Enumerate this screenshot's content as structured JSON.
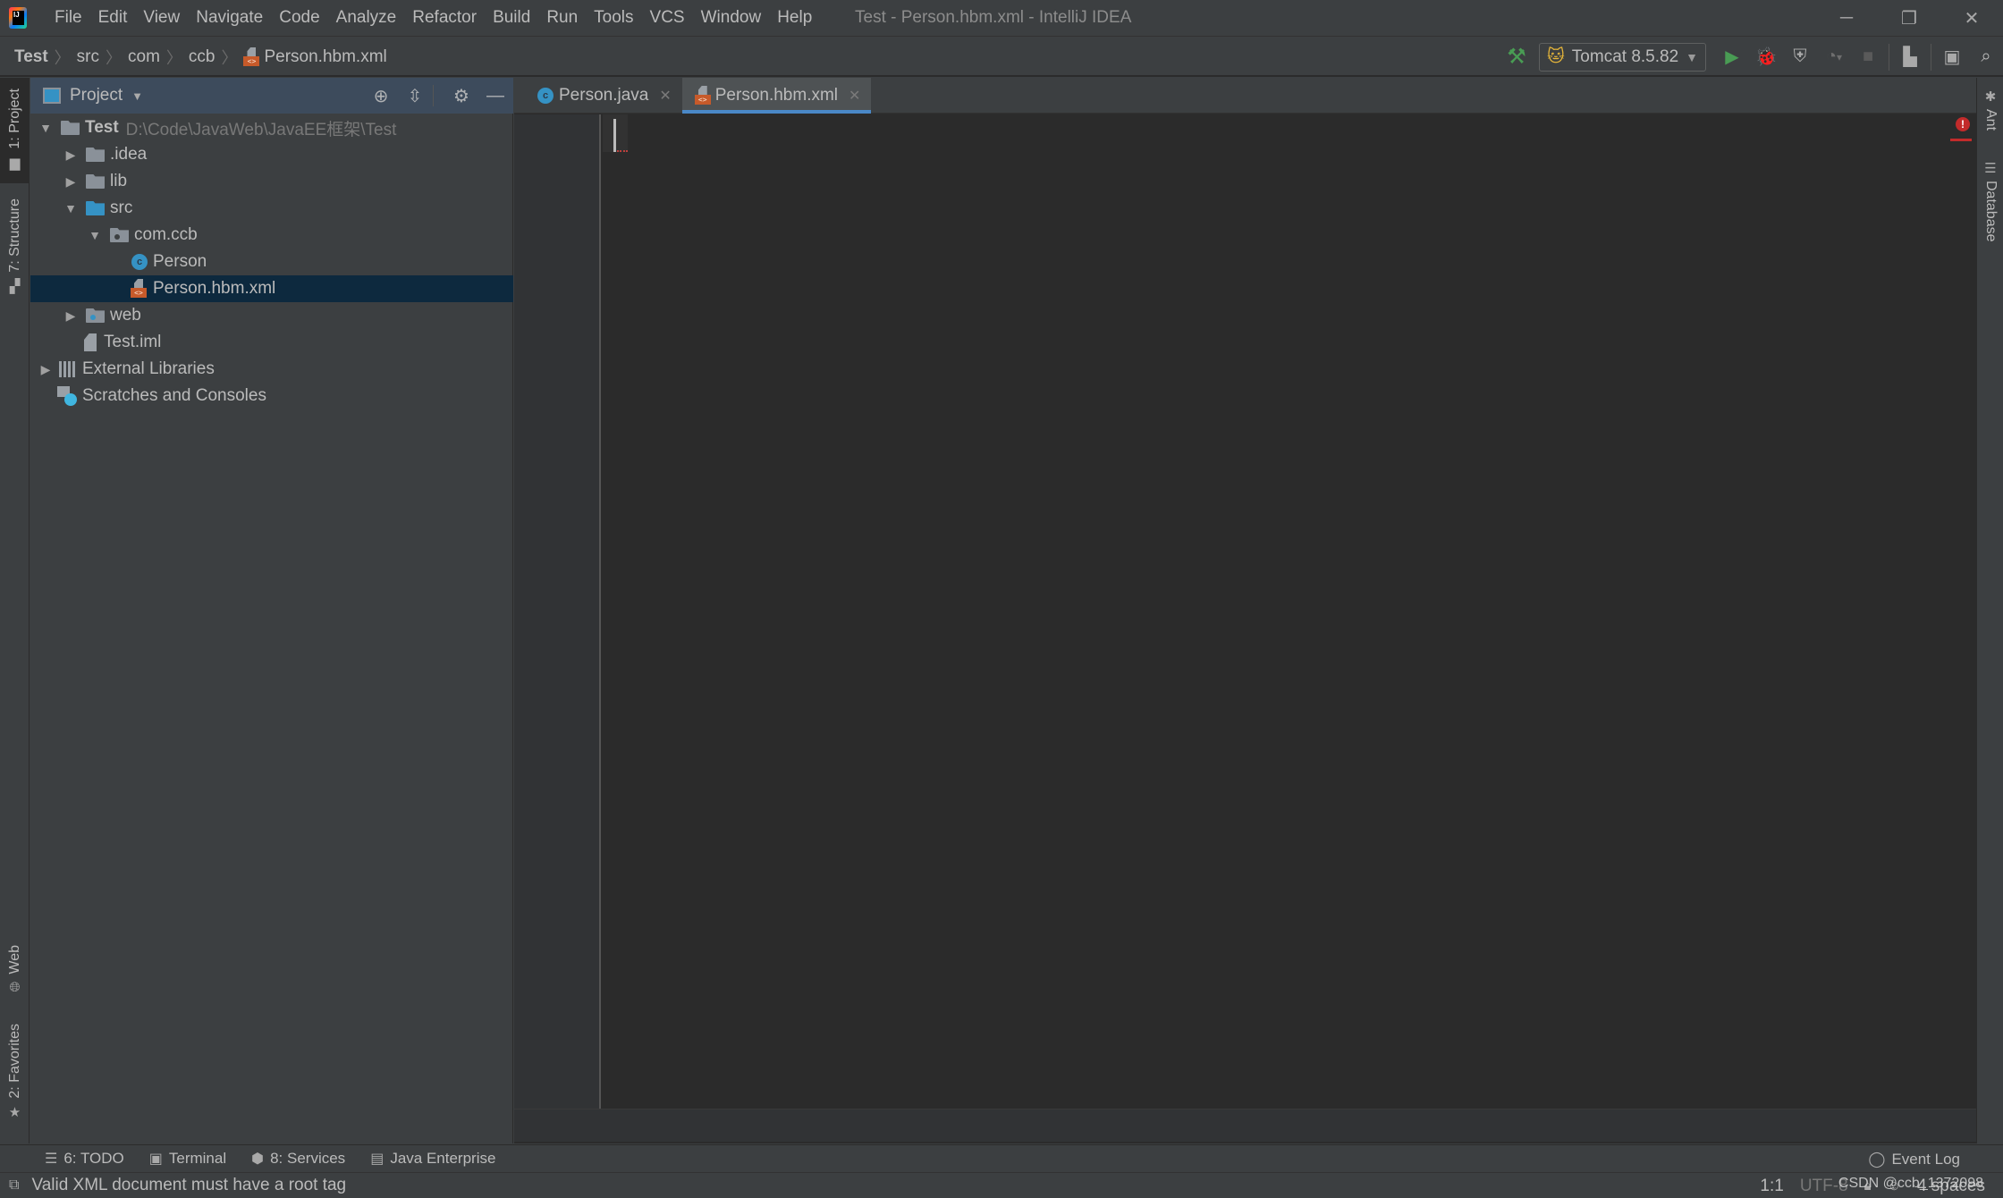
{
  "window": {
    "title": "Test - Person.hbm.xml - IntelliJ IDEA",
    "logo_glyph": "IJ",
    "controls": {
      "minimize": "─",
      "restore": "❐",
      "close": "✕"
    }
  },
  "menu": [
    "File",
    "Edit",
    "View",
    "Navigate",
    "Code",
    "Analyze",
    "Refactor",
    "Build",
    "Run",
    "Tools",
    "VCS",
    "Window",
    "Help"
  ],
  "breadcrumb": [
    "Test",
    "src",
    "com",
    "ccb",
    "Person.hbm.xml"
  ],
  "toolbar": {
    "build_icon": "hammer-icon",
    "run_config": "Tomcat 8.5.82",
    "run_config_icon": "tomcat-icon",
    "icons": [
      "run-icon",
      "debug-icon",
      "run-with-coverage-icon",
      "profile-icon",
      "stop-icon",
      "project-structure-icon",
      "run-anything-icon",
      "search-everywhere-icon"
    ]
  },
  "left_strip": {
    "tabs": [
      {
        "label": "1: Project",
        "icon": "folder-icon",
        "active": true
      },
      {
        "label": "7: Structure",
        "icon": "structure-icon",
        "active": false
      },
      {
        "label": "Web",
        "icon": "globe-icon",
        "active": false
      },
      {
        "label": "2: Favorites",
        "icon": "star-icon",
        "active": false
      }
    ]
  },
  "project_panel": {
    "title": "Project",
    "tools": [
      "locate-icon",
      "collapse-all-icon",
      "gear-icon",
      "hide-icon"
    ],
    "tree": [
      {
        "label": "Test",
        "hint": "D:\\Code\\JavaWeb\\JavaEE框架\\Test",
        "depth": 0,
        "expanded": true,
        "icon": "module-folder",
        "bold": true
      },
      {
        "label": ".idea",
        "depth": 1,
        "expanded": false,
        "icon": "folder"
      },
      {
        "label": "lib",
        "depth": 1,
        "expanded": false,
        "icon": "folder"
      },
      {
        "label": "src",
        "depth": 1,
        "expanded": true,
        "icon": "source-folder"
      },
      {
        "label": "com.ccb",
        "depth": 2,
        "expanded": true,
        "icon": "package"
      },
      {
        "label": "Person",
        "depth": 3,
        "icon": "class"
      },
      {
        "label": "Person.hbm.xml",
        "depth": 3,
        "icon": "xml",
        "selected": true
      },
      {
        "label": "web",
        "depth": 1,
        "expanded": false,
        "icon": "web-folder"
      },
      {
        "label": "Test.iml",
        "depth": 1,
        "icon": "iml"
      },
      {
        "label": "External Libraries",
        "depth": 0,
        "expanded": false,
        "icon": "libraries"
      },
      {
        "label": "Scratches and Consoles",
        "depth": 0,
        "icon": "scratches"
      }
    ]
  },
  "editor": {
    "tabs": [
      {
        "label": "Person.java",
        "icon": "class",
        "active": false
      },
      {
        "label": "Person.hbm.xml",
        "icon": "xml",
        "active": true
      }
    ],
    "content": "",
    "error_marker": "!"
  },
  "right_strip": {
    "tabs": [
      {
        "label": "Ant",
        "icon": "ant-icon"
      },
      {
        "label": "Database",
        "icon": "database-icon"
      }
    ]
  },
  "bottom_tools": [
    {
      "label": "6: TODO",
      "icon": "todo-icon"
    },
    {
      "label": "Terminal",
      "icon": "terminal-icon"
    },
    {
      "label": "8: Services",
      "icon": "services-icon"
    },
    {
      "label": "Java Enterprise",
      "icon": "java-enterprise-icon"
    }
  ],
  "event_log": "Event Log",
  "status": {
    "message": "Valid XML document must have a root tag",
    "position": "1:1",
    "encoding": "UTF-8",
    "indent": "4 spaces"
  },
  "watermark": "CSDN @ccb_1372098",
  "colors": {
    "accent": "#4a88c7",
    "selection": "#0d293e",
    "editor_bg": "#2b2b2b",
    "chrome_bg": "#3c3f41",
    "error": "#c22b2b",
    "run_green": "#499c54"
  }
}
